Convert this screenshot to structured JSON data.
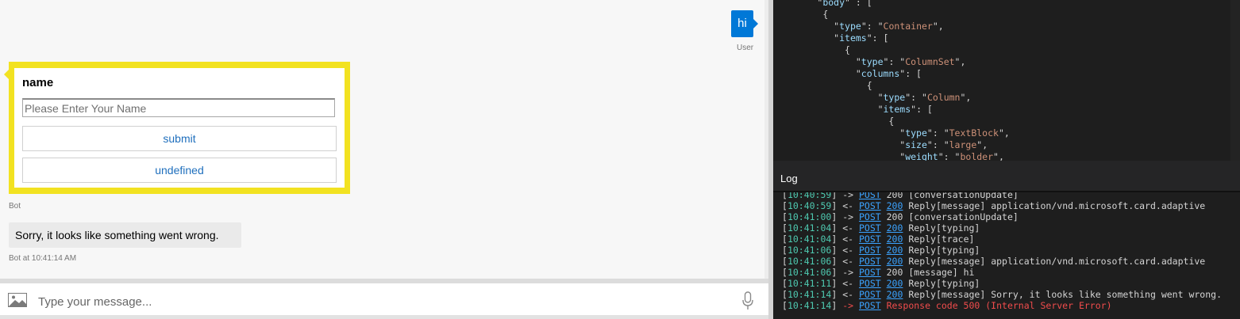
{
  "chat": {
    "user_message": "hi",
    "user_caption": "User",
    "card": {
      "title": "name",
      "input_placeholder": "Please Enter Your Name",
      "submit_label": "submit",
      "second_label": "undefined"
    },
    "bot_caption": "Bot",
    "bot_message": "Sorry, it looks like something went wrong.",
    "bot_caption_time": "Bot at 10:41:14 AM",
    "composer_placeholder": "Type your message..."
  },
  "json_view": {
    "lines": [
      {
        "indent": "        ",
        "key": "body",
        "rest": " : ["
      },
      {
        "indent": "         ",
        "key": "",
        "rest": "{"
      },
      {
        "indent": "           ",
        "key": "type",
        "rest": ": ",
        "str": "Container",
        "tail": ","
      },
      {
        "indent": "           ",
        "key": "items",
        "rest": ": ["
      },
      {
        "indent": "             ",
        "key": "",
        "rest": "{"
      },
      {
        "indent": "               ",
        "key": "type",
        "rest": ": ",
        "str": "ColumnSet",
        "tail": ","
      },
      {
        "indent": "               ",
        "key": "columns",
        "rest": ": ["
      },
      {
        "indent": "                 ",
        "key": "",
        "rest": "{"
      },
      {
        "indent": "                   ",
        "key": "type",
        "rest": ": ",
        "str": "Column",
        "tail": ","
      },
      {
        "indent": "                   ",
        "key": "items",
        "rest": ": ["
      },
      {
        "indent": "                     ",
        "key": "",
        "rest": "{"
      },
      {
        "indent": "                       ",
        "key": "type",
        "rest": ": ",
        "str": "TextBlock",
        "tail": ","
      },
      {
        "indent": "                       ",
        "key": "size",
        "rest": ": ",
        "str": "large",
        "tail": ","
      },
      {
        "indent": "                       ",
        "key": "weight",
        "rest": ": ",
        "str": "bolder",
        "tail": ","
      }
    ]
  },
  "log": {
    "title": "Log",
    "entries": [
      {
        "time": "10:40:59",
        "dir": "->",
        "method": "POST",
        "code": "200",
        "linked_code": false,
        "text": "[conversationUpdate]"
      },
      {
        "time": "10:40:59",
        "dir": "<-",
        "method": "POST",
        "code": "200",
        "linked_code": true,
        "text": "Reply[message] application/vnd.microsoft.card.adaptive"
      },
      {
        "time": "10:41:00",
        "dir": "->",
        "method": "POST",
        "code": "200",
        "linked_code": false,
        "text": "[conversationUpdate]"
      },
      {
        "time": "10:41:04",
        "dir": "<-",
        "method": "POST",
        "code": "200",
        "linked_code": true,
        "text": "Reply[typing]"
      },
      {
        "time": "10:41:04",
        "dir": "<-",
        "method": "POST",
        "code": "200",
        "linked_code": true,
        "text": "Reply[trace]"
      },
      {
        "time": "10:41:06",
        "dir": "<-",
        "method": "POST",
        "code": "200",
        "linked_code": true,
        "text": "Reply[typing]"
      },
      {
        "time": "10:41:06",
        "dir": "<-",
        "method": "POST",
        "code": "200",
        "linked_code": true,
        "text": "Reply[message] application/vnd.microsoft.card.adaptive"
      },
      {
        "time": "10:41:06",
        "dir": "->",
        "method": "POST",
        "code": "200",
        "linked_code": false,
        "text": "[message] hi"
      },
      {
        "time": "10:41:11",
        "dir": "<-",
        "method": "POST",
        "code": "200",
        "linked_code": true,
        "text": "Reply[typing]"
      },
      {
        "time": "10:41:14",
        "dir": "<-",
        "method": "POST",
        "code": "200",
        "linked_code": true,
        "text": "Reply[message] Sorry, it looks like something went wrong."
      },
      {
        "time": "10:41:14",
        "dir": "->",
        "method": "POST",
        "code": "",
        "linked_code": false,
        "error": true,
        "text": "Response code 500 (Internal Server Error)"
      }
    ]
  },
  "colors": {
    "accent": "#0078d7",
    "card_border": "#f2e221",
    "timestamp": "#4ec9b0",
    "link": "#3ba3ff",
    "error": "#f14c4c"
  }
}
